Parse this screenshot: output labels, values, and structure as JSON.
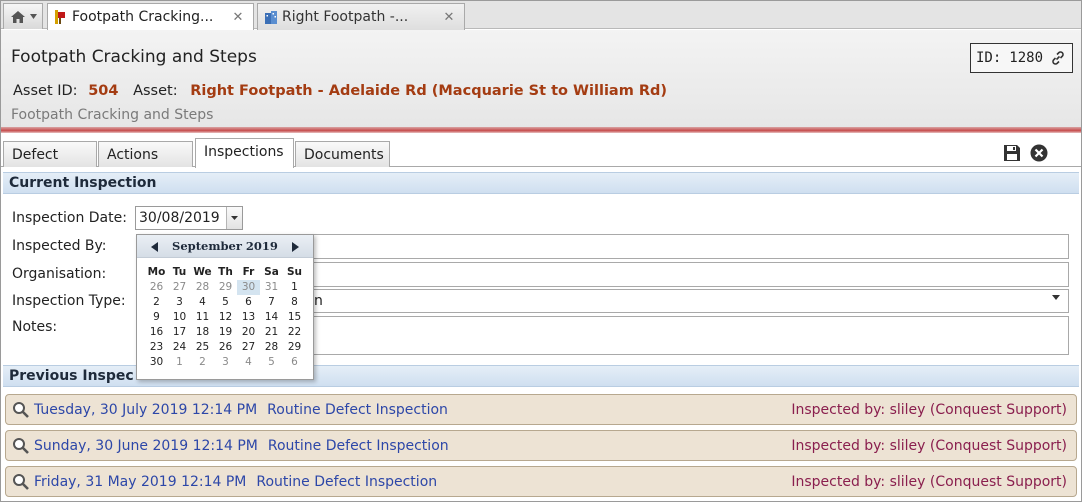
{
  "tabs": [
    {
      "label": "Footpath Cracking...",
      "close": "✕"
    },
    {
      "label": "Right Footpath -...",
      "close": "✕"
    }
  ],
  "header": {
    "title": "Footpath Cracking and Steps",
    "id_label": "ID:",
    "id_value": "1280",
    "asset_id_label": "Asset ID:",
    "asset_id_value": "504",
    "asset_label": "Asset:",
    "asset_value": "Right Footpath - Adelaide Rd (Macquarie St to William Rd)",
    "subtitle": "Footpath Cracking and Steps"
  },
  "inner_tabs": [
    {
      "label": "Defect"
    },
    {
      "label": "Actions"
    },
    {
      "label": "Inspections"
    },
    {
      "label": "Documents"
    }
  ],
  "current": {
    "heading": "Current Inspection",
    "date_label": "Inspection Date:",
    "date_value": "30/08/2019",
    "inspected_by_label": "Inspected By:",
    "organisation_label": "Organisation:",
    "type_label": "Inspection Type:",
    "type_value_visible": "n",
    "notes_label": "Notes:"
  },
  "calendar": {
    "month": "September 2019",
    "dow": [
      "Mo",
      "Tu",
      "We",
      "Th",
      "Fr",
      "Sa",
      "Su"
    ],
    "weeks": [
      [
        "26",
        "27",
        "28",
        "29",
        "30",
        "31",
        "1"
      ],
      [
        "2",
        "3",
        "4",
        "5",
        "6",
        "7",
        "8"
      ],
      [
        "9",
        "10",
        "11",
        "12",
        "13",
        "14",
        "15"
      ],
      [
        "16",
        "17",
        "18",
        "19",
        "20",
        "21",
        "22"
      ],
      [
        "23",
        "24",
        "25",
        "26",
        "27",
        "28",
        "29"
      ],
      [
        "30",
        "1",
        "2",
        "3",
        "4",
        "5",
        "6"
      ]
    ]
  },
  "previous": {
    "heading": "Previous Inspections",
    "heading_visible": "Previous Inspec",
    "rows": [
      {
        "date": "Tuesday, 30 July 2019 12:14 PM",
        "type": "Routine Defect Inspection",
        "by": "Inspected by: sliley (Conquest Support)"
      },
      {
        "date": "Sunday, 30 June 2019 12:14 PM",
        "type": "Routine Defect Inspection",
        "by": "Inspected by: sliley (Conquest Support)"
      },
      {
        "date": "Friday, 31 May 2019 12:14 PM",
        "type": "Routine Defect Inspection",
        "by": "Inspected by: sliley (Conquest Support)"
      }
    ]
  },
  "colors": {
    "asset_accent": "#a43c12",
    "link_blue": "#2d47a8",
    "inspector_text": "#8a1f4e",
    "row_bg": "#ede3d4",
    "header_rule": "#c64c4c"
  }
}
